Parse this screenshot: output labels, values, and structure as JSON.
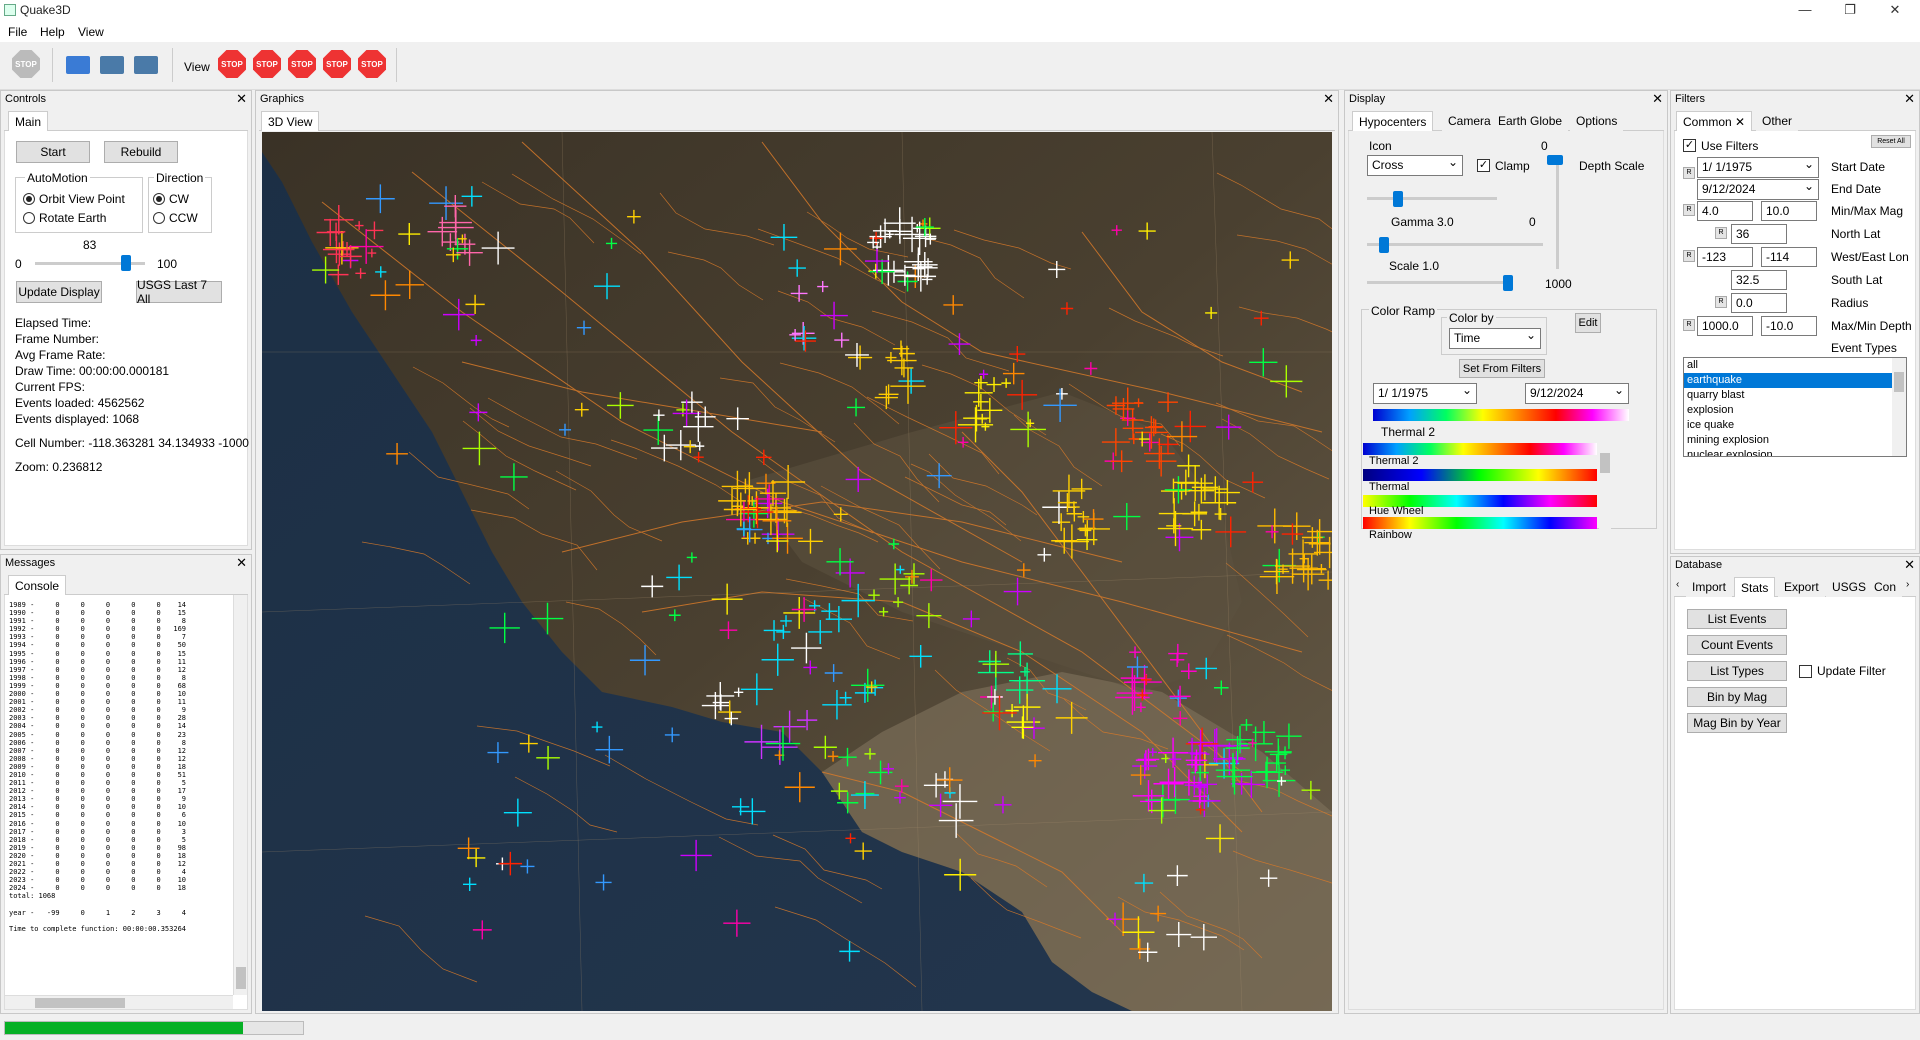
{
  "window": {
    "title": "Quake3D",
    "minimize": "—",
    "maximize": "❐",
    "close": "✕"
  },
  "menu": [
    "File",
    "Help",
    "View"
  ],
  "toolbar": {
    "view_label": "View",
    "stop_label": "STOP"
  },
  "controls": {
    "title": "Controls",
    "tab": "Main",
    "start": "Start",
    "rebuild": "Rebuild",
    "automotion_label": "AutoMotion",
    "orbit": "Orbit View Point",
    "rotate": "Rotate Earth",
    "direction_label": "Direction",
    "cw": "CW",
    "ccw": "CCW",
    "slider_value": "83",
    "slider_min": "0",
    "slider_max": "100",
    "slider_fraction": 0.83,
    "update_display": "Update Display",
    "usgs_last": "USGS Last 7 All",
    "stats": [
      "Elapsed Time:",
      "Frame Number:",
      "Avg Frame Rate:",
      "Draw Time: 00:00:00.000181",
      "Current FPS:",
      "Events loaded: 4562562",
      "Events displayed: 1068"
    ],
    "cell_number": "Cell Number: -118.363281 34.134933 -1000",
    "zoom": "Zoom: 0.236812"
  },
  "messages": {
    "title": "Messages",
    "tab": "Console",
    "lines": [
      "1989 -     0     0     0     0     0    14",
      "1990 -     0     0     0     0     0    15",
      "1991 -     0     0     0     0     0     8",
      "1992 -     0     0     0     0     0   169",
      "1993 -     0     0     0     0     0     7",
      "1994 -     0     0     0     0     0    50",
      "1995 -     0     0     0     0     0    15",
      "1996 -     0     0     0     0     0    11",
      "1997 -     0     0     0     0     0    12",
      "1998 -     0     0     0     0     0     8",
      "1999 -     0     0     0     0     0    68",
      "2000 -     0     0     0     0     0    10",
      "2001 -     0     0     0     0     0    11",
      "2002 -     0     0     0     0     0     9",
      "2003 -     0     0     0     0     0    28",
      "2004 -     0     0     0     0     0    14",
      "2005 -     0     0     0     0     0    23",
      "2006 -     0     0     0     0     0     8",
      "2007 -     0     0     0     0     0    12",
      "2008 -     0     0     0     0     0    12",
      "2009 -     0     0     0     0     0    18",
      "2010 -     0     0     0     0     0    51",
      "2011 -     0     0     0     0     0     5",
      "2012 -     0     0     0     0     0    17",
      "2013 -     0     0     0     0     0     9",
      "2014 -     0     0     0     0     0    10",
      "2015 -     0     0     0     0     0     6",
      "2016 -     0     0     0     0     0    10",
      "2017 -     0     0     0     0     0     3",
      "2018 -     0     0     0     0     0     5",
      "2019 -     0     0     0     0     0    98",
      "2020 -     0     0     0     0     0    18",
      "2021 -     0     0     0     0     0    12",
      "2022 -     0     0     0     0     0     4",
      "2023 -     0     0     0     0     0    10",
      "2024 -     0     0     0     0     0    18",
      "total: 1068",
      "",
      "year -   -99     0     1     2     3     4",
      "",
      "Time to complete function: 00:00:00.353264"
    ]
  },
  "graphics": {
    "title": "Graphics",
    "tab": "3D View"
  },
  "display": {
    "title": "Display",
    "tabs": [
      "Hypocenters",
      "Camera",
      "Earth Globe",
      "Options"
    ],
    "icon_label": "Icon",
    "icon_value": "Cross",
    "clamp": "Clamp",
    "depth_scale": "Depth Scale",
    "depth_top": "0",
    "depth_bottom": "1000",
    "gamma": "Gamma 3.0",
    "gamma_right": "0",
    "scale": "Scale 1.0",
    "color_ramp": "Color Ramp",
    "color_by": "Color by",
    "color_by_value": "Time",
    "edit": "Edit",
    "set_from_filters": "Set From Filters",
    "date_from": "1/  1/1975",
    "date_to": "9/12/2024",
    "current_ramp": "Thermal 2",
    "ramps": [
      "Thermal 2",
      "Thermal",
      "Hue Wheel",
      "Rainbow"
    ]
  },
  "filters": {
    "title": "Filters",
    "tabs": [
      "Common",
      "Other"
    ],
    "reset": "Reset All",
    "use_filters": "Use Filters",
    "start_date": "1/  1/1975",
    "start_date_label": "Start Date",
    "end_date": "9/12/2024",
    "end_date_label": "End Date",
    "min_mag": "4.0",
    "max_mag": "10.0",
    "mag_label": "Min/Max Mag",
    "north_lat": "36",
    "north_label": "North Lat",
    "west_lon": "-123",
    "east_lon": "-114",
    "lon_label": "West/East Lon",
    "south_lat": "32.5",
    "south_label": "South Lat",
    "radius": "0.0",
    "radius_label": "Radius",
    "max_depth": "1000.0",
    "min_depth": "-10.0",
    "depth_label": "Max/Min Depth",
    "event_types_label": "Event Types",
    "event_types": [
      "all",
      "earthquake",
      "quarry blast",
      "explosion",
      "ice quake",
      "mining explosion",
      "nuclear explosion"
    ],
    "r": "R"
  },
  "database": {
    "title": "Database",
    "tabs": [
      "Import",
      "Stats",
      "Export",
      "USGS",
      "Con"
    ],
    "list_events": "List Events",
    "count_events": "Count Events",
    "list_types": "List Types",
    "update_filter": "Update Filter",
    "bin_by_mag": "Bin by Mag",
    "mag_bin_by_year": "Mag Bin by Year"
  },
  "progress": {
    "fraction": 0.8
  },
  "colors": {
    "accent": "#0078d7",
    "progress": "#06b025",
    "stop": "#e33333"
  }
}
